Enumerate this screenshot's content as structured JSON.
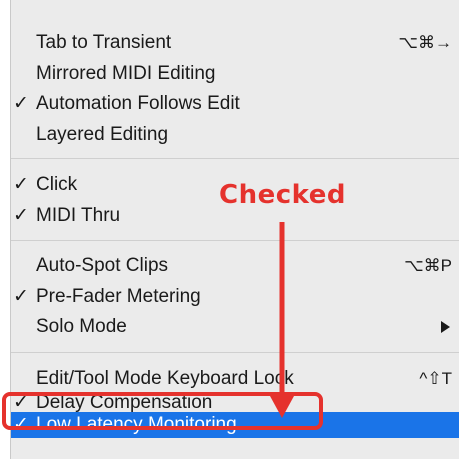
{
  "menu": {
    "items": [
      {
        "label": "Tab to Transient",
        "checked": false,
        "shortcut": "⌥⌘→"
      },
      {
        "label": "Mirrored MIDI Editing",
        "checked": false,
        "shortcut": ""
      },
      {
        "label": "Automation Follows Edit",
        "checked": true,
        "shortcut": ""
      },
      {
        "label": "Layered Editing",
        "checked": false,
        "shortcut": ""
      },
      {
        "label": "Click",
        "checked": true,
        "shortcut": ""
      },
      {
        "label": "MIDI Thru",
        "checked": true,
        "shortcut": ""
      },
      {
        "label": "Auto-Spot Clips",
        "checked": false,
        "shortcut": "⌥⌘P"
      },
      {
        "label": "Pre-Fader Metering",
        "checked": true,
        "shortcut": ""
      },
      {
        "label": "Solo Mode",
        "checked": false,
        "shortcut": "",
        "submenu": true
      },
      {
        "label": "Edit/Tool Mode Keyboard Lock",
        "checked": false,
        "shortcut": "^⇧T"
      },
      {
        "label": "Delay Compensation",
        "checked": true,
        "shortcut": ""
      },
      {
        "label": "Low Latency Monitoring",
        "checked": true,
        "shortcut": "",
        "highlighted": true
      }
    ],
    "check_glyph": "✓"
  },
  "annotation": {
    "label": "Checked",
    "color": "#e5322d"
  },
  "colors": {
    "menu_bg": "#ebebeb",
    "highlight": "#1a74e8",
    "separator": "#cfcfcf"
  }
}
